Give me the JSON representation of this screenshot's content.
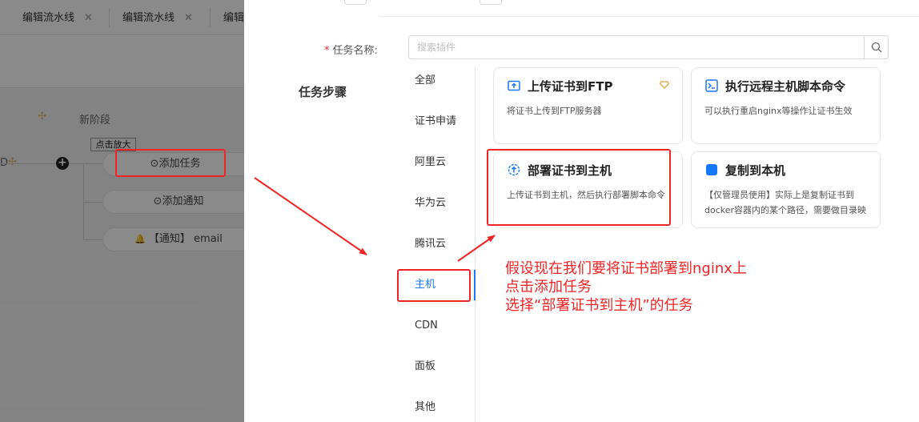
{
  "tabs": [
    {
      "label": "编辑流水线",
      "close": "✕"
    },
    {
      "label": "编辑流水线",
      "close": "✕"
    },
    {
      "label": "编辑"
    }
  ],
  "pipeline": {
    "stage_name": "新阶段",
    "tooltip": "点击放大",
    "left_edge_text": "D",
    "add_task": "⊙添加任务",
    "add_notice": "⊙添加通知",
    "notice_item": "【通知】 email"
  },
  "form": {
    "task_name_label": "任务名称:",
    "required_mark": "*",
    "steps_title": "任务步骤"
  },
  "search": {
    "placeholder": "搜索插件"
  },
  "categories": [
    {
      "label": "全部"
    },
    {
      "label": "证书申请"
    },
    {
      "label": "阿里云"
    },
    {
      "label": "华为云"
    },
    {
      "label": "腾讯云"
    },
    {
      "label": "主机"
    },
    {
      "label": "CDN"
    },
    {
      "label": "面板"
    },
    {
      "label": "其他"
    }
  ],
  "active_category": "主机",
  "plugins": [
    {
      "title": "上传证书到FTP",
      "desc": "将证书上传到FTP服务器",
      "icon": "upload-ftp-icon",
      "vip": true
    },
    {
      "title": "执行远程主机脚本命令",
      "desc": "可以执行重启nginx等操作让证书生效",
      "icon": "terminal-icon",
      "vip": false
    },
    {
      "title": "部署证书到主机",
      "desc": "上传证书到主机，然后执行部署脚本命令",
      "icon": "deploy-icon",
      "vip": false
    },
    {
      "title": "复制到本机",
      "desc": "【仅管理员使用】实际上是复制证书到docker容器内的某个路径，需要做目录映",
      "icon": "copy-icon",
      "vip": false
    }
  ],
  "annotation": {
    "line1": "假设现在我们要将证书部署到nginx上",
    "line2": "点击添加任务",
    "line3": "选择“部署证书到主机”的任务"
  },
  "colors": {
    "accent": "#1677ff",
    "annotation_red": "#f02424",
    "vip_gold": "#e6a23c"
  }
}
